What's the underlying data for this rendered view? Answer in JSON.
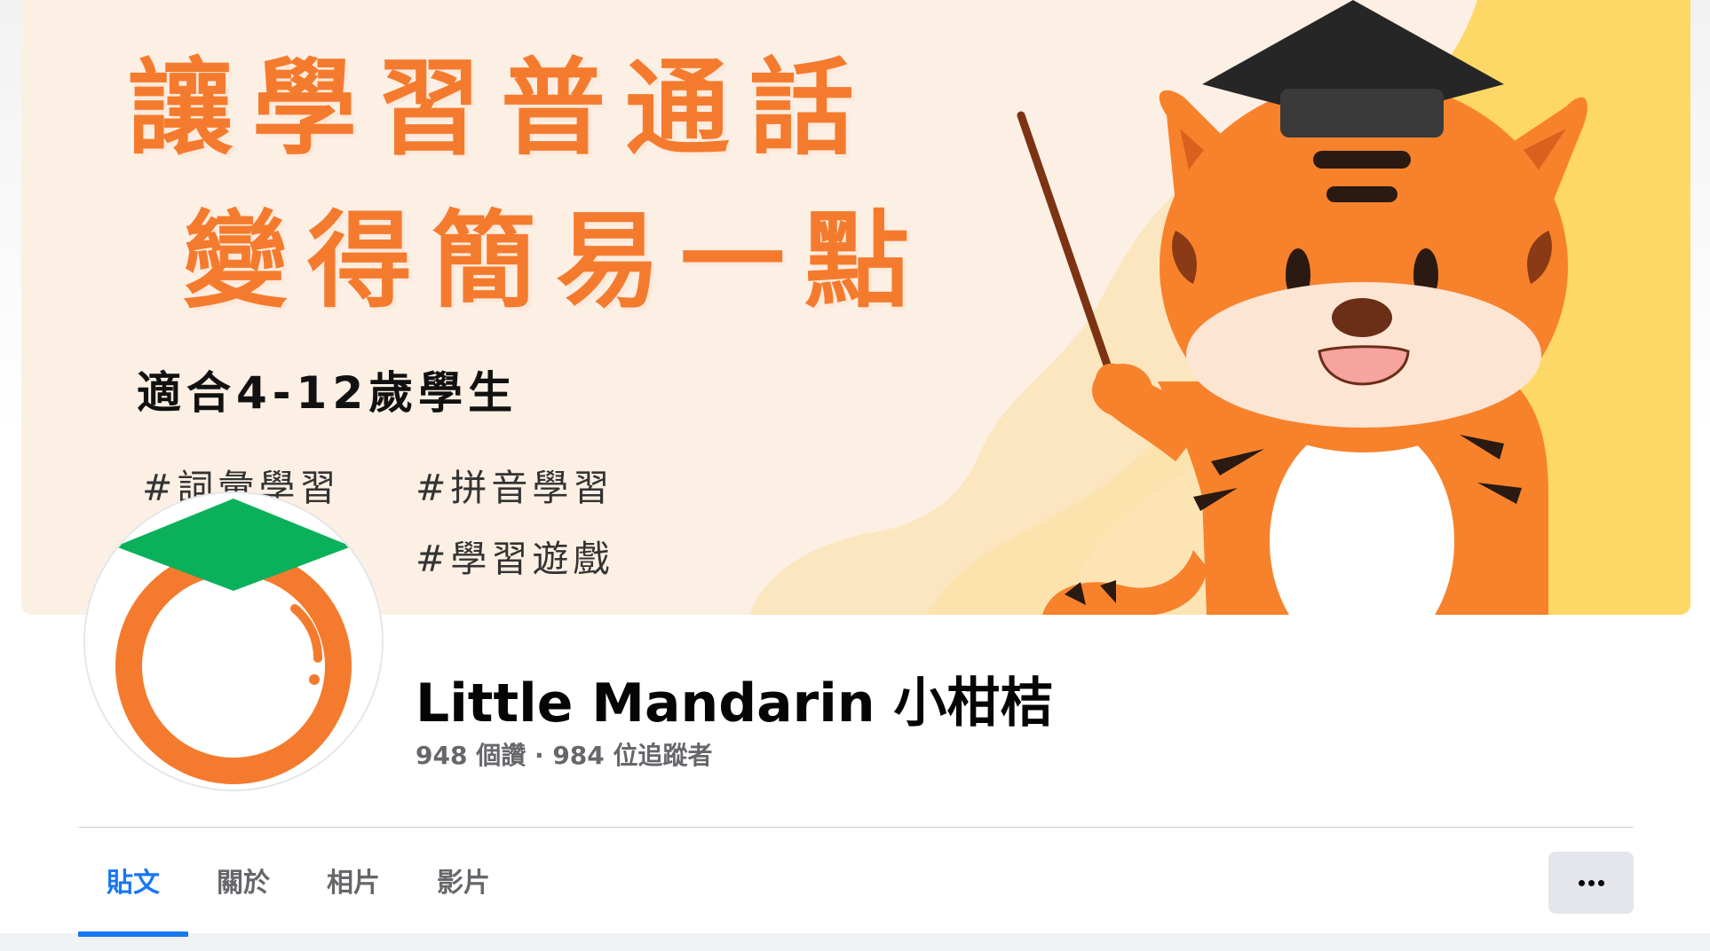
{
  "cover": {
    "headline_line1": "讓學習普通話",
    "headline_line2": "變得簡易一點",
    "age_text": "適合4-12歲學生",
    "tags": [
      "#詞彙學習",
      "#拼音學習",
      "#學習遊戲"
    ]
  },
  "page": {
    "name": "Little Mandarin 小柑桔",
    "stats": "948 個讚 · 984 位追蹤者"
  },
  "tabs": [
    {
      "label": "貼文",
      "active": true
    },
    {
      "label": "關於",
      "active": false
    },
    {
      "label": "相片",
      "active": false
    },
    {
      "label": "影片",
      "active": false
    }
  ],
  "icons": {
    "more": "more-horizontal-icon",
    "avatar": "orange-graduation-cap-logo"
  },
  "colors": {
    "accent": "#1877f2",
    "headline_orange": "#f47b2e",
    "avatar_green": "#0bb05b",
    "tiger_orange": "#f7822b"
  }
}
